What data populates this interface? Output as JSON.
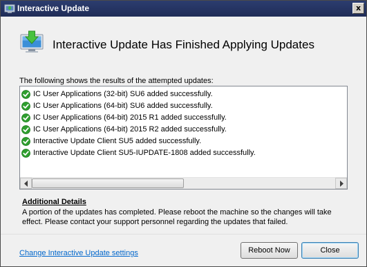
{
  "window": {
    "title": "Interactive Update",
    "close_glyph": "x"
  },
  "header": {
    "heading": "Interactive Update Has Finished Applying Updates",
    "icon": "download-to-computer-icon"
  },
  "results": {
    "intro": "The following shows the results of the attempted updates:",
    "status_icon": "green-check-icon",
    "items": [
      "IC User Applications (32-bit) SU6 added successfully.",
      "IC User Applications (64-bit) SU6 added successfully.",
      "IC User Applications (64-bit) 2015 R1 added successfully.",
      "IC User Applications (64-bit) 2015 R2 added successfully.",
      "Interactive Update Client SU5 added successfully.",
      "Interactive Update Client SU5-IUPDATE-1808 added successfully."
    ]
  },
  "details": {
    "title": "Additional Details",
    "text": "A portion of the updates has completed.  Please reboot the machine so the changes will take effect.  Please contact your support personnel regarding the updates that failed."
  },
  "footer": {
    "settings_link": "Change Interactive Update settings",
    "reboot_label": "Reboot Now",
    "close_label": "Close"
  },
  "colors": {
    "titlebar": "#2c3d6f",
    "link": "#0066cc",
    "success": "#2e9e2e"
  }
}
